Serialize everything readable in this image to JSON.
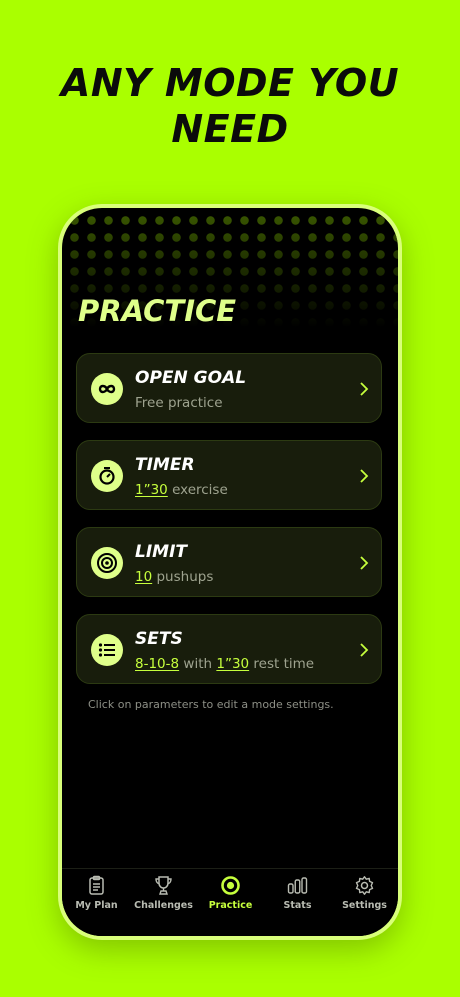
{
  "headline": "ANY MODE YOU NEED",
  "screen_title": "PRACTICE",
  "modes": [
    {
      "name": "OPEN GOAL",
      "sub_text": "Free practice",
      "icon": "infinity-icon"
    },
    {
      "name": "TIMER",
      "param": "1”30",
      "sub_text": "exercise",
      "icon": "timer-icon"
    },
    {
      "name": "LIMIT",
      "param": "10",
      "sub_text": "pushups",
      "icon": "target-icon"
    },
    {
      "name": "SETS",
      "param": "8-10-8",
      "mid_text": "with",
      "param2": "1”30",
      "sub_text": "rest time",
      "icon": "list-icon"
    }
  ],
  "hint": "Click on parameters to edit a mode settings.",
  "tabs": [
    {
      "label": "My Plan",
      "icon": "clipboard-icon"
    },
    {
      "label": "Challenges",
      "icon": "trophy-icon"
    },
    {
      "label": "Practice",
      "icon": "practice-icon",
      "active": true
    },
    {
      "label": "Stats",
      "icon": "stats-icon"
    },
    {
      "label": "Settings",
      "icon": "gear-icon"
    }
  ],
  "colors": {
    "background": "#aaff00",
    "accent": "#c6ff3d",
    "card": "#181d0c",
    "text": "#ffffff",
    "muted": "#9ea38f"
  }
}
